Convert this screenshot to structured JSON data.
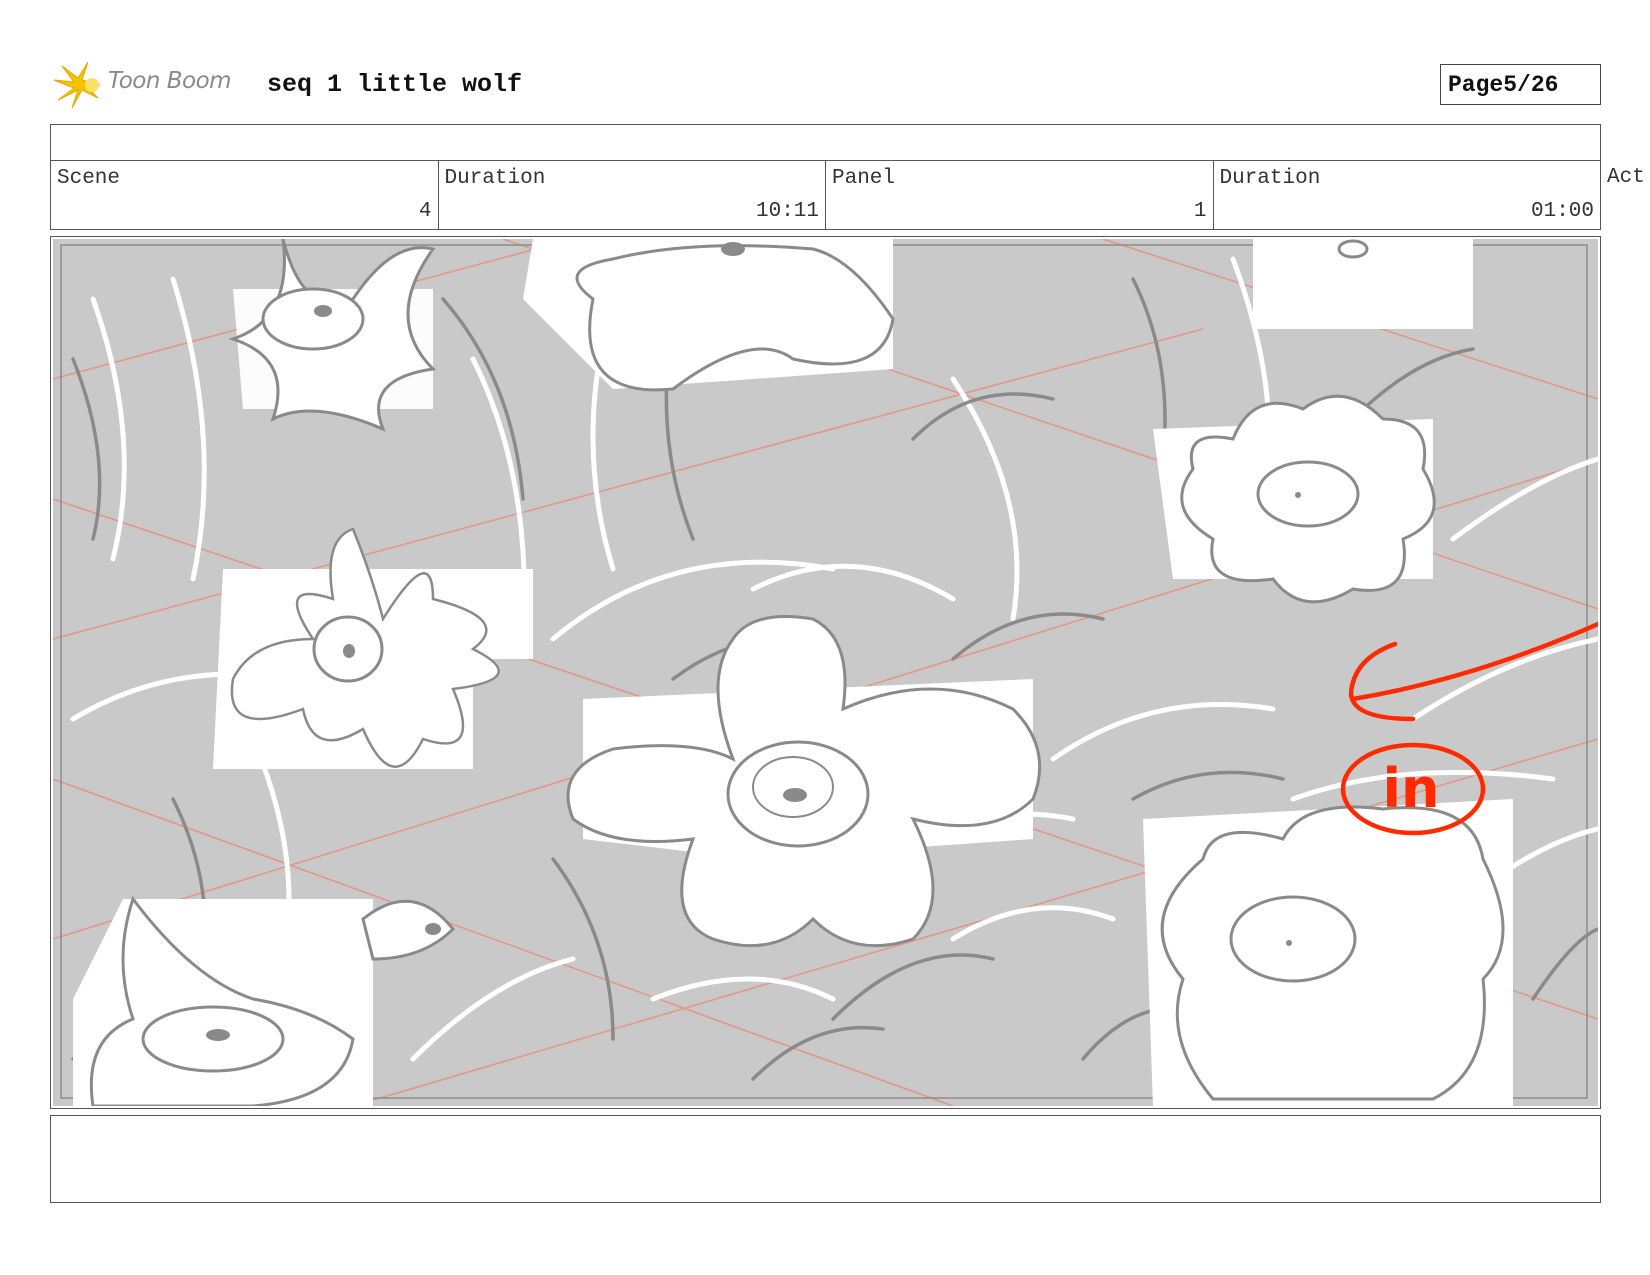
{
  "header": {
    "brand": "Toon Boom",
    "title": "seq 1 little wolf",
    "page_label": "Page",
    "page_value": "5/26"
  },
  "info": {
    "scene_label": "Scene",
    "scene_value": "4",
    "scene_duration_label": "Duration",
    "scene_duration_value": "10:11",
    "panel_label": "Panel",
    "panel_value": "1",
    "panel_duration_label": "Duration",
    "panel_duration_value": "01:00",
    "action_label": "Act"
  },
  "panel": {
    "annotation": "in",
    "annotation_color": "#ff2a00",
    "background_color": "#c9c9c9",
    "guide_line_color": "#e8907a"
  },
  "colors": {
    "logo_star": "#f5c400",
    "frame_border": "#555555"
  }
}
